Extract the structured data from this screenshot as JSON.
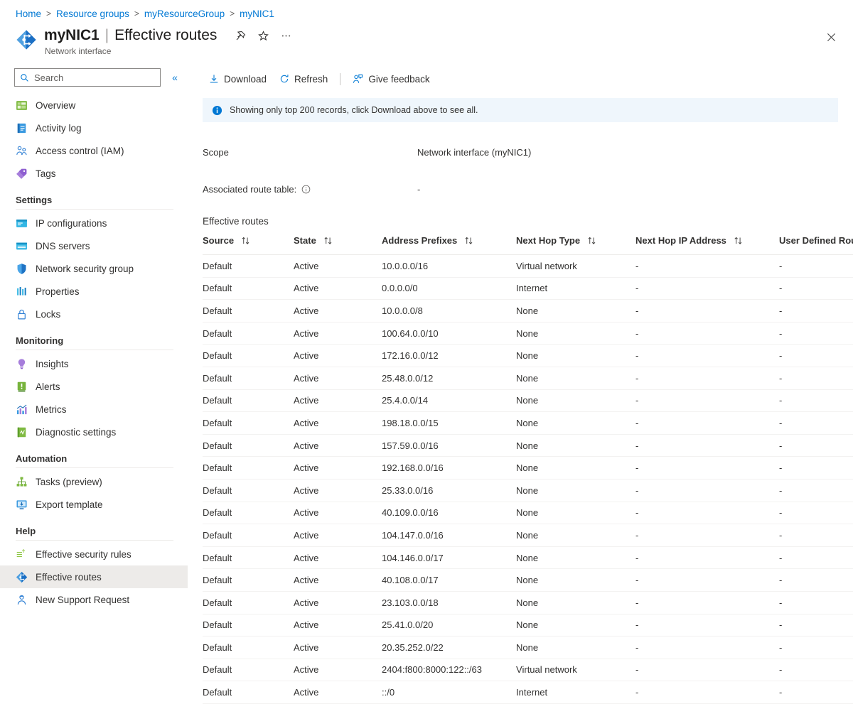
{
  "breadcrumb": [
    {
      "label": "Home"
    },
    {
      "label": "Resource groups"
    },
    {
      "label": "myResourceGroup"
    },
    {
      "label": "myNIC1"
    }
  ],
  "breadcrumb_separator": ">",
  "header": {
    "resource_name": "myNIC1",
    "separator": "|",
    "page_name": "Effective routes",
    "subtitle": "Network interface",
    "pin_icon": "pin-icon",
    "favorite_icon": "star-icon",
    "more_icon": "ellipsis-icon",
    "close_icon": "close-icon",
    "resource_icon": "network-interface-icon"
  },
  "sidebar": {
    "search": {
      "placeholder": "Search",
      "value": "",
      "icon": "search-icon"
    },
    "collapse_icon": "chevron-double-left-icon",
    "items": [
      {
        "label": "Overview",
        "icon": "overview-icon",
        "selected": false
      },
      {
        "label": "Activity log",
        "icon": "activity-log-icon",
        "selected": false
      },
      {
        "label": "Access control (IAM)",
        "icon": "access-control-icon",
        "selected": false
      },
      {
        "label": "Tags",
        "icon": "tags-icon",
        "selected": false
      }
    ],
    "groups": [
      {
        "title": "Settings",
        "items": [
          {
            "label": "IP configurations",
            "icon": "ip-configurations-icon",
            "selected": false
          },
          {
            "label": "DNS servers",
            "icon": "dns-servers-icon",
            "selected": false
          },
          {
            "label": "Network security group",
            "icon": "network-security-group-icon",
            "selected": false
          },
          {
            "label": "Properties",
            "icon": "properties-icon",
            "selected": false
          },
          {
            "label": "Locks",
            "icon": "lock-icon",
            "selected": false
          }
        ]
      },
      {
        "title": "Monitoring",
        "items": [
          {
            "label": "Insights",
            "icon": "insights-icon",
            "selected": false
          },
          {
            "label": "Alerts",
            "icon": "alerts-icon",
            "selected": false
          },
          {
            "label": "Metrics",
            "icon": "metrics-icon",
            "selected": false
          },
          {
            "label": "Diagnostic settings",
            "icon": "diagnostic-settings-icon",
            "selected": false
          }
        ]
      },
      {
        "title": "Automation",
        "items": [
          {
            "label": "Tasks (preview)",
            "icon": "tasks-icon",
            "selected": false
          },
          {
            "label": "Export template",
            "icon": "export-template-icon",
            "selected": false
          }
        ]
      },
      {
        "title": "Help",
        "items": [
          {
            "label": "Effective security rules",
            "icon": "effective-security-rules-icon",
            "selected": false
          },
          {
            "label": "Effective routes",
            "icon": "effective-routes-icon",
            "selected": true
          },
          {
            "label": "New Support Request",
            "icon": "support-request-icon",
            "selected": false
          }
        ]
      }
    ]
  },
  "toolbar": {
    "download_label": "Download",
    "download_icon": "download-icon",
    "refresh_label": "Refresh",
    "refresh_icon": "refresh-icon",
    "feedback_label": "Give feedback",
    "feedback_icon": "feedback-icon"
  },
  "info_bar": {
    "icon": "info-icon",
    "message": "Showing only top 200 records, click Download above to see all."
  },
  "details": {
    "scope_label": "Scope",
    "scope_value": "Network interface (myNIC1)",
    "route_table_label": "Associated route table:",
    "route_table_info_icon": "info-circle-icon",
    "route_table_value": "-",
    "section_title": "Effective routes"
  },
  "table": {
    "sort_icon": "sort-arrows-icon",
    "columns": [
      "Source",
      "State",
      "Address Prefixes",
      "Next Hop Type",
      "Next Hop IP Address",
      "User Defined Route Name"
    ],
    "rows": [
      {
        "source": "Default",
        "state": "Active",
        "prefix": "10.0.0.0/16",
        "hop_type": "Virtual network",
        "hop_ip": "-",
        "udr": "-"
      },
      {
        "source": "Default",
        "state": "Active",
        "prefix": "0.0.0.0/0",
        "hop_type": "Internet",
        "hop_ip": "-",
        "udr": "-"
      },
      {
        "source": "Default",
        "state": "Active",
        "prefix": "10.0.0.0/8",
        "hop_type": "None",
        "hop_ip": "-",
        "udr": "-"
      },
      {
        "source": "Default",
        "state": "Active",
        "prefix": "100.64.0.0/10",
        "hop_type": "None",
        "hop_ip": "-",
        "udr": "-"
      },
      {
        "source": "Default",
        "state": "Active",
        "prefix": "172.16.0.0/12",
        "hop_type": "None",
        "hop_ip": "-",
        "udr": "-"
      },
      {
        "source": "Default",
        "state": "Active",
        "prefix": "25.48.0.0/12",
        "hop_type": "None",
        "hop_ip": "-",
        "udr": "-"
      },
      {
        "source": "Default",
        "state": "Active",
        "prefix": "25.4.0.0/14",
        "hop_type": "None",
        "hop_ip": "-",
        "udr": "-"
      },
      {
        "source": "Default",
        "state": "Active",
        "prefix": "198.18.0.0/15",
        "hop_type": "None",
        "hop_ip": "-",
        "udr": "-"
      },
      {
        "source": "Default",
        "state": "Active",
        "prefix": "157.59.0.0/16",
        "hop_type": "None",
        "hop_ip": "-",
        "udr": "-"
      },
      {
        "source": "Default",
        "state": "Active",
        "prefix": "192.168.0.0/16",
        "hop_type": "None",
        "hop_ip": "-",
        "udr": "-"
      },
      {
        "source": "Default",
        "state": "Active",
        "prefix": "25.33.0.0/16",
        "hop_type": "None",
        "hop_ip": "-",
        "udr": "-"
      },
      {
        "source": "Default",
        "state": "Active",
        "prefix": "40.109.0.0/16",
        "hop_type": "None",
        "hop_ip": "-",
        "udr": "-"
      },
      {
        "source": "Default",
        "state": "Active",
        "prefix": "104.147.0.0/16",
        "hop_type": "None",
        "hop_ip": "-",
        "udr": "-"
      },
      {
        "source": "Default",
        "state": "Active",
        "prefix": "104.146.0.0/17",
        "hop_type": "None",
        "hop_ip": "-",
        "udr": "-"
      },
      {
        "source": "Default",
        "state": "Active",
        "prefix": "40.108.0.0/17",
        "hop_type": "None",
        "hop_ip": "-",
        "udr": "-"
      },
      {
        "source": "Default",
        "state": "Active",
        "prefix": "23.103.0.0/18",
        "hop_type": "None",
        "hop_ip": "-",
        "udr": "-"
      },
      {
        "source": "Default",
        "state": "Active",
        "prefix": "25.41.0.0/20",
        "hop_type": "None",
        "hop_ip": "-",
        "udr": "-"
      },
      {
        "source": "Default",
        "state": "Active",
        "prefix": "20.35.252.0/22",
        "hop_type": "None",
        "hop_ip": "-",
        "udr": "-"
      },
      {
        "source": "Default",
        "state": "Active",
        "prefix": "2404:f800:8000:122::/63",
        "hop_type": "Virtual network",
        "hop_ip": "-",
        "udr": "-"
      },
      {
        "source": "Default",
        "state": "Active",
        "prefix": "::/0",
        "hop_type": "Internet",
        "hop_ip": "-",
        "udr": "-"
      }
    ]
  },
  "colors": {
    "accent": "#0078d4",
    "info_bg": "#eff6fc",
    "selected_bg": "#edebe9",
    "text": "#323130"
  }
}
